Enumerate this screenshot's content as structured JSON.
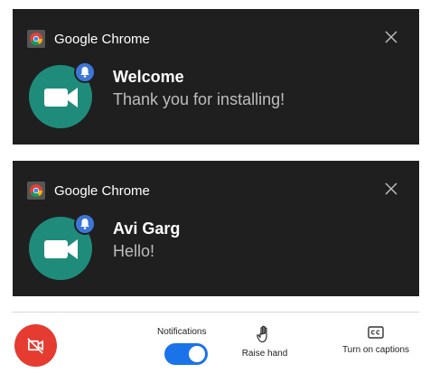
{
  "notifications": [
    {
      "app_name": "Google Chrome",
      "title": "Welcome",
      "body": "Thank you for installing!",
      "icon": "google-meet-icon",
      "badge_icon": "bell-icon"
    },
    {
      "app_name": "Google Chrome",
      "title": "Avi Garg",
      "body": "Hello!",
      "icon": "google-meet-icon",
      "badge_icon": "bell-icon"
    }
  ],
  "controls": {
    "end_call_icon": "camera-off-icon",
    "notifications_label": "Notifications",
    "notifications_enabled": true,
    "raise_hand_label": "Raise hand",
    "captions_label": "Turn on captions"
  },
  "colors": {
    "toast_bg": "#1f1f1f",
    "meet_icon_bg": "#1f8c7b",
    "badge_bg": "#3d76d8",
    "end_call_bg": "#e53b30",
    "toggle_on": "#1a73e8"
  }
}
